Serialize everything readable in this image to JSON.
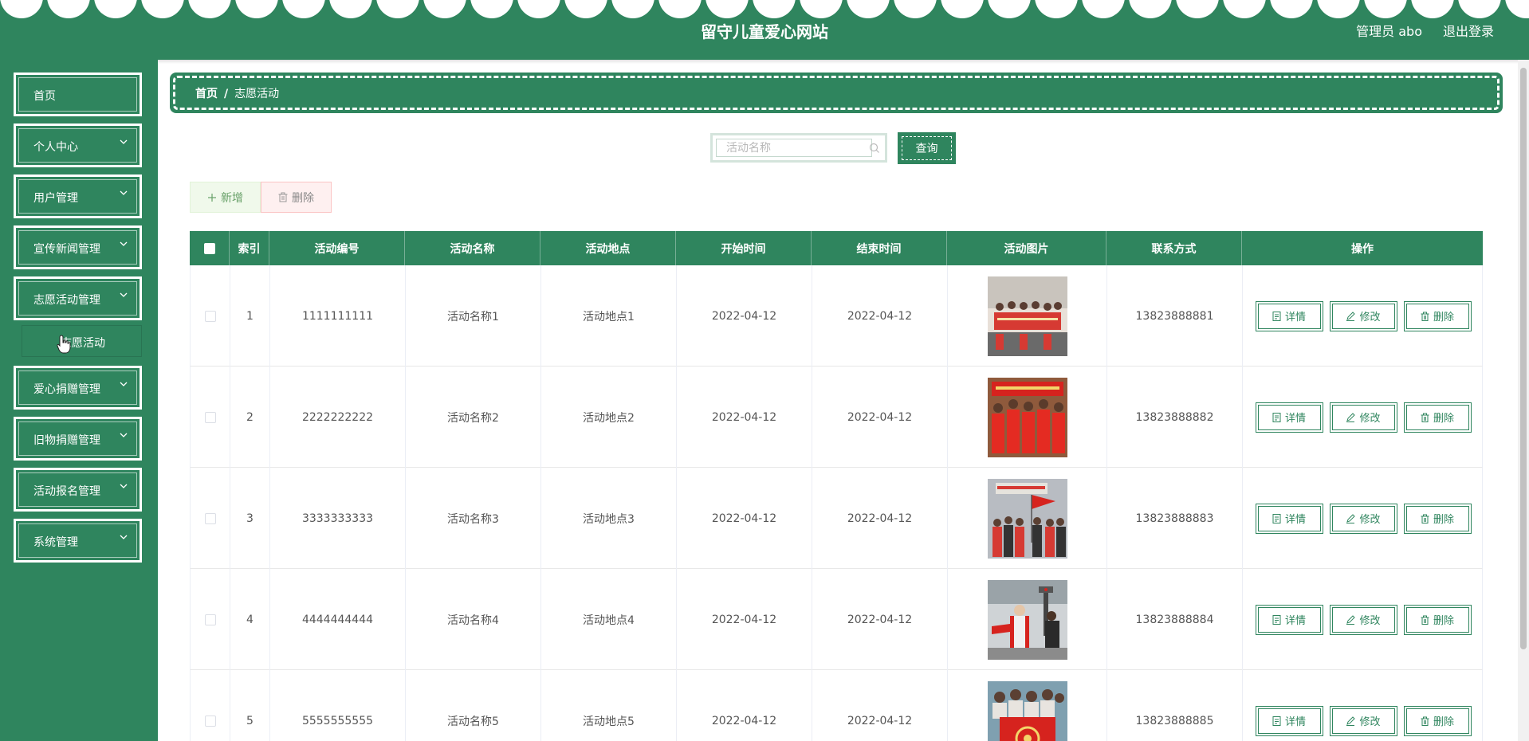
{
  "header": {
    "title": "留守儿童爱心网站",
    "user": "管理员 abo",
    "logout": "退出登录"
  },
  "sidebar": {
    "items": [
      {
        "label": "首页",
        "has_chevron": false
      },
      {
        "label": "个人中心",
        "has_chevron": true
      },
      {
        "label": "用户管理",
        "has_chevron": true
      },
      {
        "label": "宣传新闻管理",
        "has_chevron": true
      },
      {
        "label": "志愿活动管理",
        "has_chevron": true
      },
      {
        "label": "爱心捐赠管理",
        "has_chevron": true
      },
      {
        "label": "旧物捐赠管理",
        "has_chevron": true
      },
      {
        "label": "活动报名管理",
        "has_chevron": true
      },
      {
        "label": "系统管理",
        "has_chevron": true
      }
    ],
    "submenu_label": "志愿活动"
  },
  "breadcrumb": {
    "home": "首页",
    "separator": "/",
    "current": "志愿活动"
  },
  "search": {
    "placeholder": "活动名称",
    "button": "查询"
  },
  "actions": {
    "add": "新增",
    "delete": "删除"
  },
  "table": {
    "headers": [
      "索引",
      "活动编号",
      "活动名称",
      "活动地点",
      "开始时间",
      "结束时间",
      "活动图片",
      "联系方式",
      "操作"
    ],
    "rows": [
      {
        "index": "1",
        "code": "1111111111",
        "name": "活动名称1",
        "place": "活动地点1",
        "start": "2022-04-12",
        "end": "2022-04-12",
        "phone": "13823888881"
      },
      {
        "index": "2",
        "code": "2222222222",
        "name": "活动名称2",
        "place": "活动地点2",
        "start": "2022-04-12",
        "end": "2022-04-12",
        "phone": "13823888882"
      },
      {
        "index": "3",
        "code": "3333333333",
        "name": "活动名称3",
        "place": "活动地点3",
        "start": "2022-04-12",
        "end": "2022-04-12",
        "phone": "13823888883"
      },
      {
        "index": "4",
        "code": "4444444444",
        "name": "活动名称4",
        "place": "活动地点4",
        "start": "2022-04-12",
        "end": "2022-04-12",
        "phone": "13823888884"
      },
      {
        "index": "5",
        "code": "5555555555",
        "name": "活动名称5",
        "place": "活动地点5",
        "start": "2022-04-12",
        "end": "2022-04-12",
        "phone": "13823888885"
      }
    ],
    "row_actions": {
      "detail": "详情",
      "edit": "修改",
      "delete": "删除"
    }
  },
  "colors": {
    "primary": "#2f855e",
    "white": "#ffffff"
  }
}
